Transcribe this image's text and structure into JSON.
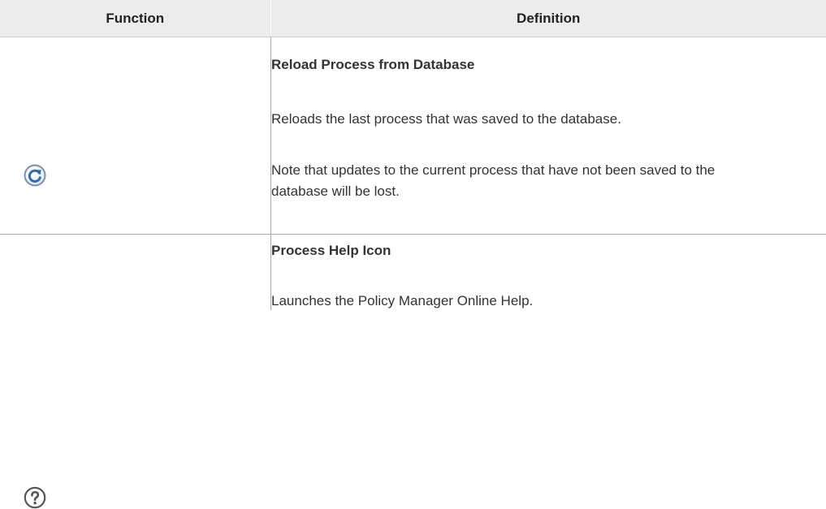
{
  "table": {
    "headers": {
      "function": "Function",
      "definition": "Definition"
    },
    "rows": [
      {
        "icon": "reload-icon",
        "title": "Reload Process from Database",
        "paragraphs": [
          "Reloads the last process that was saved to the database.",
          "Note that updates to the current process that have not been saved to the database will be lost."
        ]
      },
      {
        "icon": "help-icon",
        "title": "Process Help Icon",
        "paragraphs": [
          "Launches the Policy Manager Online Help."
        ]
      }
    ]
  },
  "colors": {
    "header_bg": "#ececec",
    "text": "#333333",
    "border": "#a9a9a9",
    "reload_icon_blue": "#2f6bb3",
    "help_icon_gray": "#555555"
  }
}
